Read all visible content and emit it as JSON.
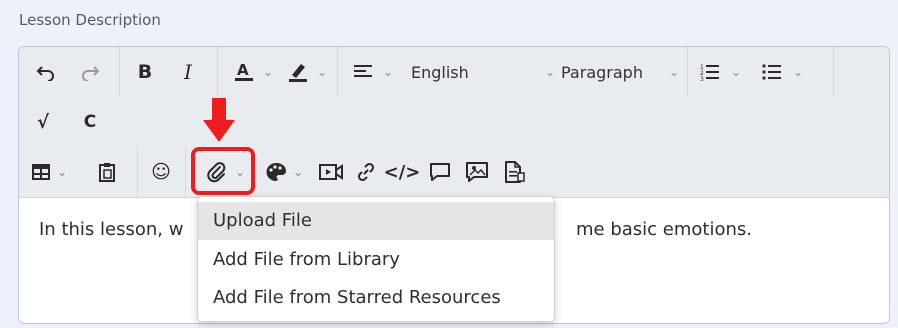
{
  "section": {
    "label": "Lesson Description"
  },
  "toolbar": {
    "language": "English",
    "block_format": "Paragraph",
    "icons": {
      "undo": "undo-icon",
      "redo": "redo-icon",
      "bold": "B",
      "italic": "I",
      "text_color": "A",
      "highlight": "highlight-pen-icon",
      "align": "align-left-icon",
      "ordered_list": "ordered-list-icon",
      "bullet_list": "bullet-list-icon",
      "row2_left": "√",
      "row2_right": "C",
      "table": "table-icon",
      "paste": "paste-icon",
      "emoji": "☺",
      "attachment": "paperclip-icon",
      "palette": "palette-icon",
      "video": "video-icon",
      "link": "link-icon",
      "code": "</>",
      "comment": "comment-icon",
      "image_comment": "image-comment-icon",
      "file_text": "file-text-icon"
    }
  },
  "content": {
    "text_left": "In this lesson, w",
    "text_right": "me basic emotions."
  },
  "attachment_menu": {
    "items": [
      {
        "label": "Upload File",
        "active": true
      },
      {
        "label": "Add File from Library",
        "active": false
      },
      {
        "label": "Add File from Starred Resources",
        "active": false
      }
    ]
  },
  "colors": {
    "page_bg": "#eef1f9",
    "toolbar_bg": "#e8ebf0",
    "editor_border": "#b9c8e0",
    "callout_red": "#ee1c1c",
    "menu_hover": "#e5e5e5"
  }
}
